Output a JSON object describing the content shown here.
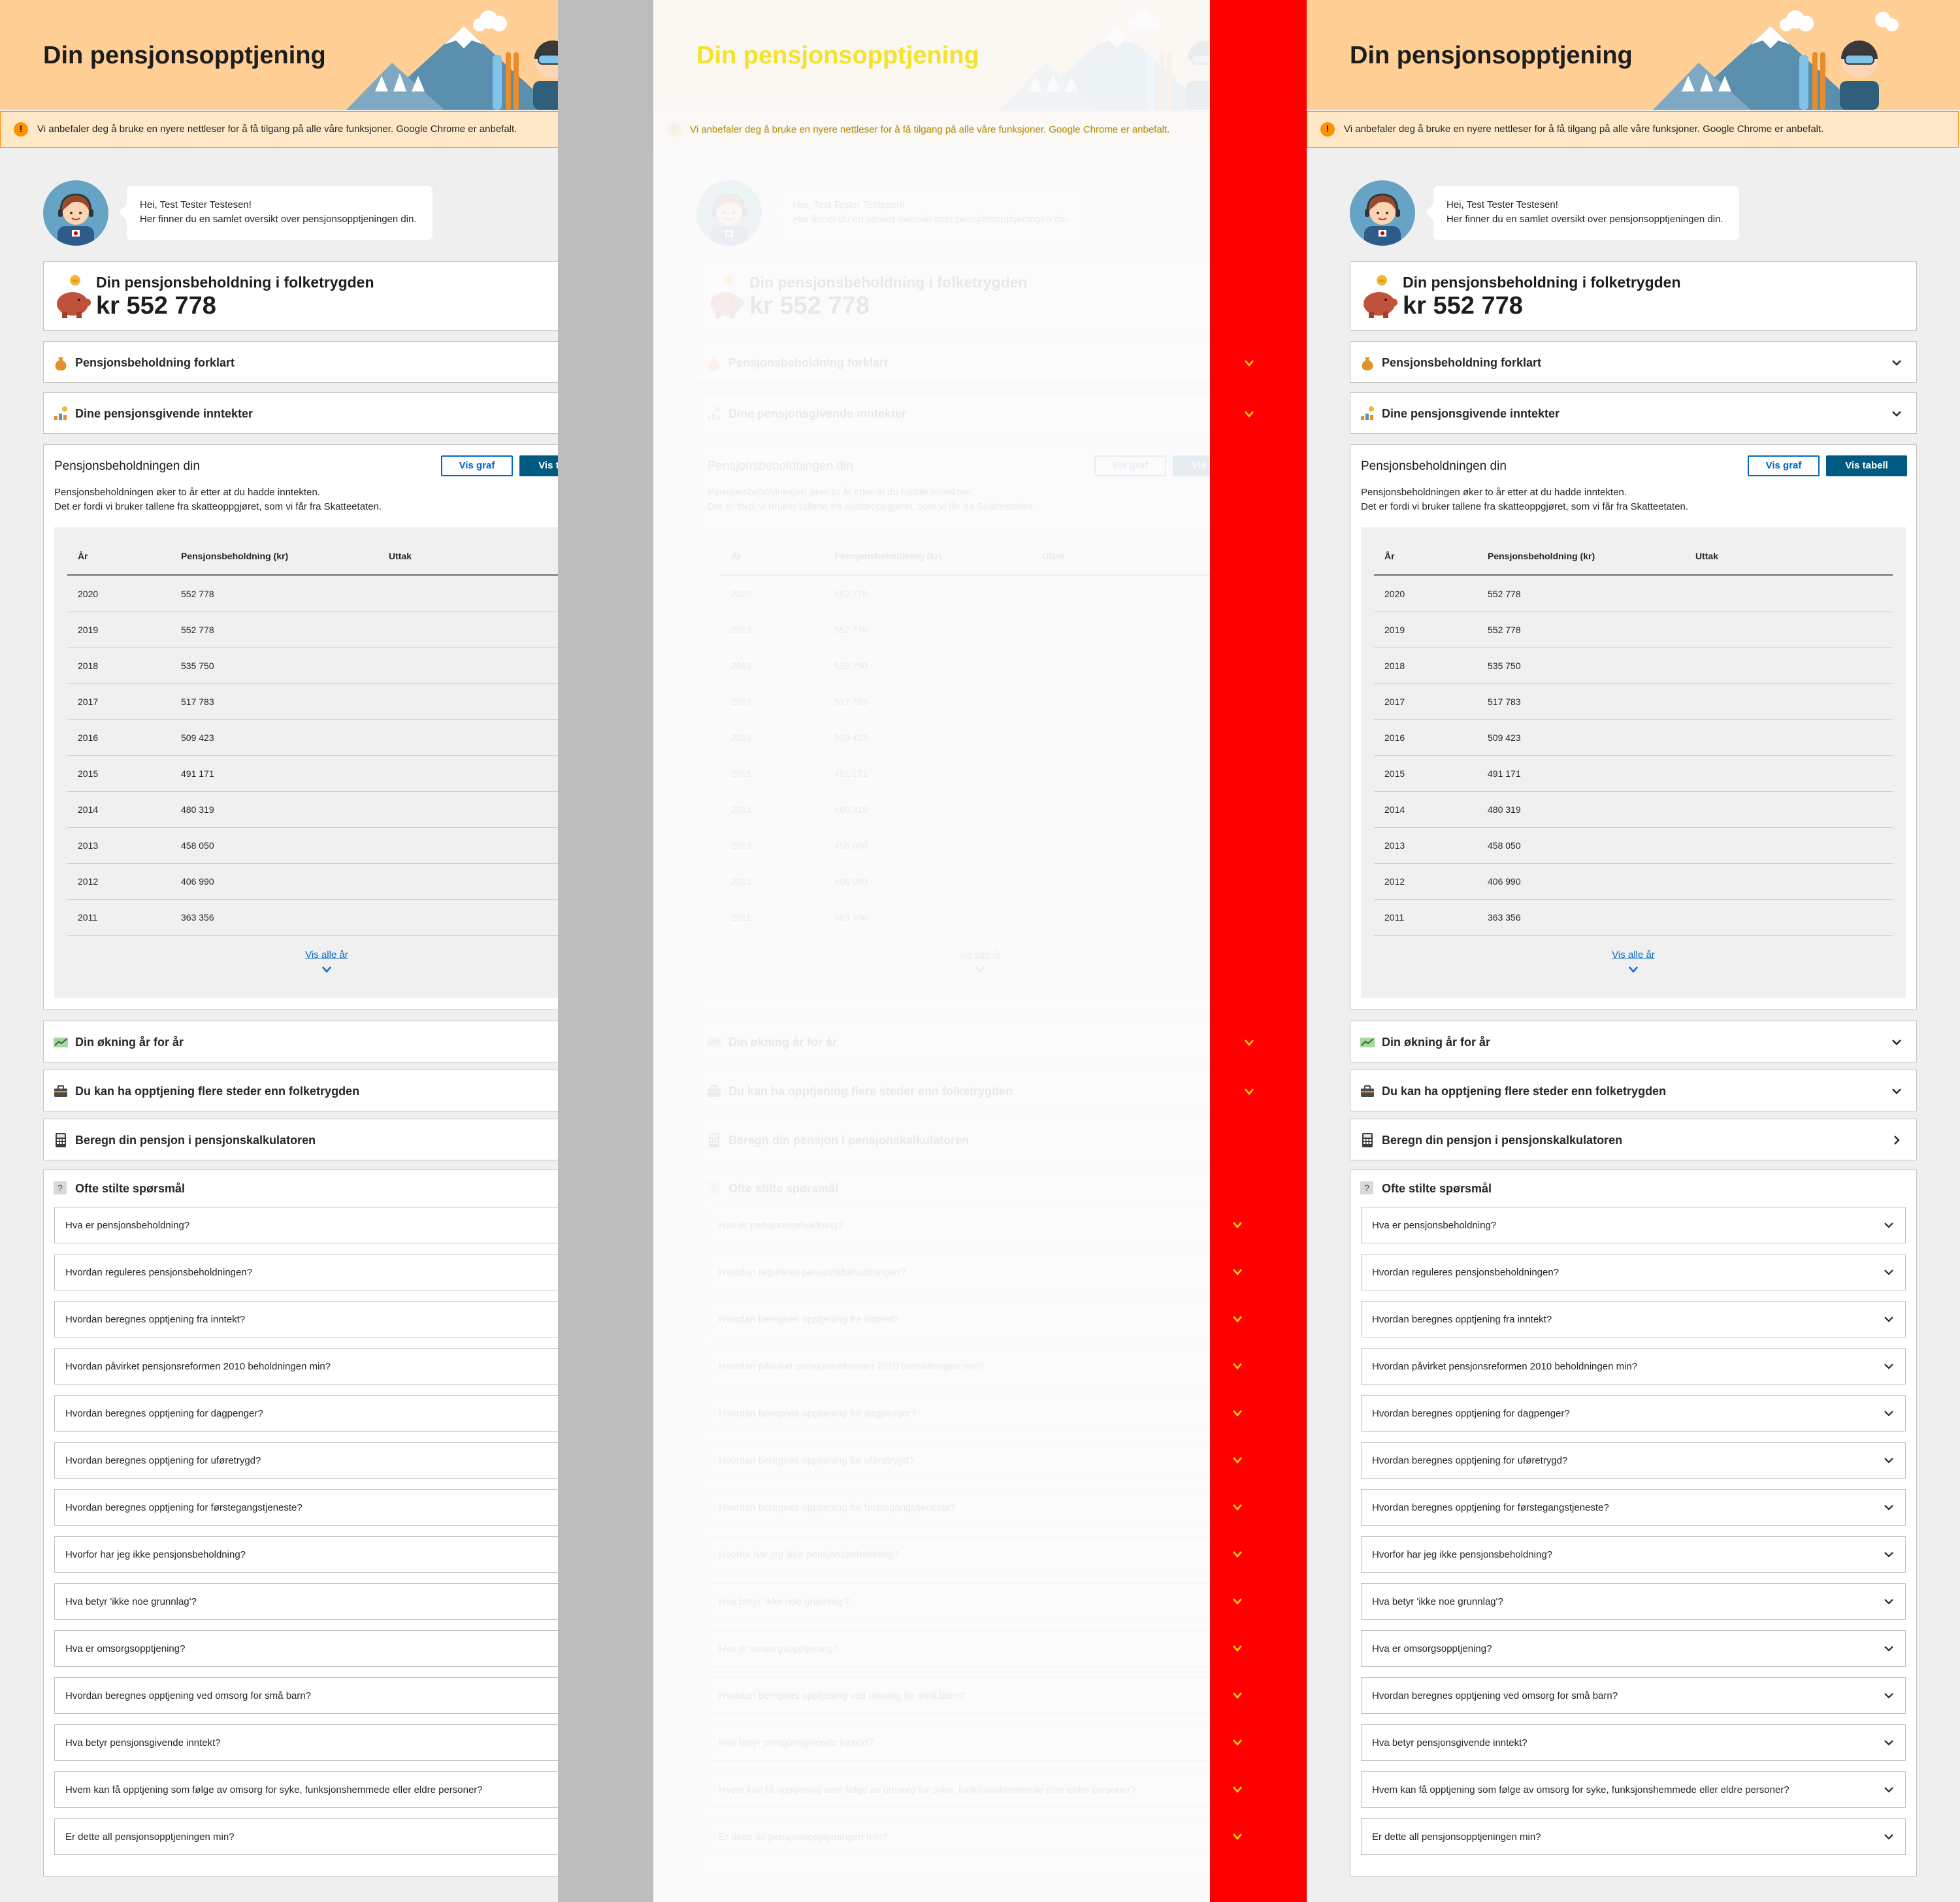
{
  "header": {
    "title": "Din pensjonsopptjening"
  },
  "browser_warning": {
    "icon": "warning-icon",
    "text": "Vi anbefaler deg å bruke en nyere nettleser for å få tilgang på alle våre funksjoner. Google Chrome er anbefalt."
  },
  "greeting": {
    "line1": "Hei, Test Tester Testesen!",
    "line2": "Her finner du en samlet oversikt over pensjonsopptjeningen din."
  },
  "total": {
    "label": "Din pensjonsbeholdning i folketrygden",
    "value": "kr 552 778"
  },
  "sections": {
    "explained": "Pensjonsbeholdning forklart",
    "income": "Dine pensjonsgivende inntekter",
    "increase": "Din økning år for år",
    "other_places": "Du kan ha opptjening flere steder enn folketrygden",
    "calculator": "Beregn din pensjon i pensjonskalkulatoren",
    "faq": "Ofte stilte spørsmål"
  },
  "balance": {
    "title": "Pensjonsbeholdningen din",
    "btn_graph": "Vis graf",
    "btn_table": "Vis tabell",
    "desc1": "Pensjonsbeholdningen øker to år etter at du hadde inntekten.",
    "desc2": "Det er fordi vi bruker tallene fra skatteoppgjøret, som vi får fra Skatteetaten.",
    "columns": [
      "År",
      "Pensjonsbeholdning (kr)",
      "Uttak"
    ],
    "rows": [
      [
        "2020",
        "552 778"
      ],
      [
        "2019",
        "552 778"
      ],
      [
        "2018",
        "535 750"
      ],
      [
        "2017",
        "517 783"
      ],
      [
        "2016",
        "509 423"
      ],
      [
        "2015",
        "491 171"
      ],
      [
        "2014",
        "480 319"
      ],
      [
        "2013",
        "458 050"
      ],
      [
        "2012",
        "406 990"
      ],
      [
        "2011",
        "363 356"
      ]
    ],
    "show_all": "Vis alle år"
  },
  "faq": [
    "Hva er pensjonsbeholdning?",
    "Hvordan reguleres pensjonsbeholdningen?",
    "Hvordan beregnes opptjening fra inntekt?",
    "Hvordan påvirket pensjonsreformen 2010 beholdningen min?",
    "Hvordan beregnes opptjening for dagpenger?",
    "Hvordan beregnes opptjening for uføretrygd?",
    "Hvordan beregnes opptjening for førstegangstjeneste?",
    "Hvorfor har jeg ikke pensjonsbeholdning?",
    "Hva betyr 'ikke noe grunnlag'?",
    "Hva er omsorgsopptjening?",
    "Hvordan beregnes opptjening ved omsorg for små barn?",
    "Hva betyr pensjonsgivende inntekt?",
    "Hvem kan få opptjening som følge av omsorg for syke, funksjonshemmede eller eldre personer?",
    "Er dette all pensjonsopptjeningen min?"
  ],
  "colors": {
    "header_bg": "#ffcf96",
    "warning_border": "#ff9100",
    "primary": "#0067c5",
    "table_btn": "#005b82",
    "diff_red": "#ff0000"
  }
}
